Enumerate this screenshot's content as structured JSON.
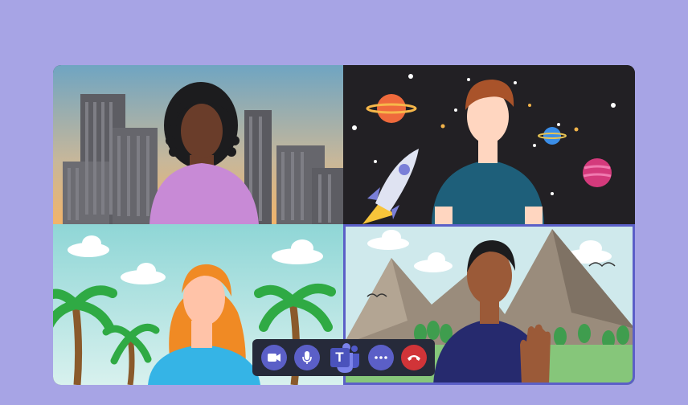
{
  "call": {
    "participants": [
      {
        "name": "city-participant",
        "background": "city"
      },
      {
        "name": "space-participant",
        "background": "space"
      },
      {
        "name": "beach-participant",
        "background": "beach"
      },
      {
        "name": "mountain-participant",
        "background": "mountains",
        "active_speaker": true
      }
    ]
  },
  "controls": {
    "buttons": [
      {
        "id": "camera",
        "icon": "video-camera-icon"
      },
      {
        "id": "mic",
        "icon": "microphone-icon"
      },
      {
        "id": "teams",
        "icon": "teams-logo-icon",
        "letter": "T"
      },
      {
        "id": "more",
        "icon": "more-dots-icon"
      },
      {
        "id": "hangup",
        "icon": "hang-up-phone-icon"
      }
    ]
  },
  "colors": {
    "background": "#a7a4e5",
    "accent": "#5b5fc7",
    "hangup": "#d13438",
    "toolbar": "#262a3a"
  }
}
